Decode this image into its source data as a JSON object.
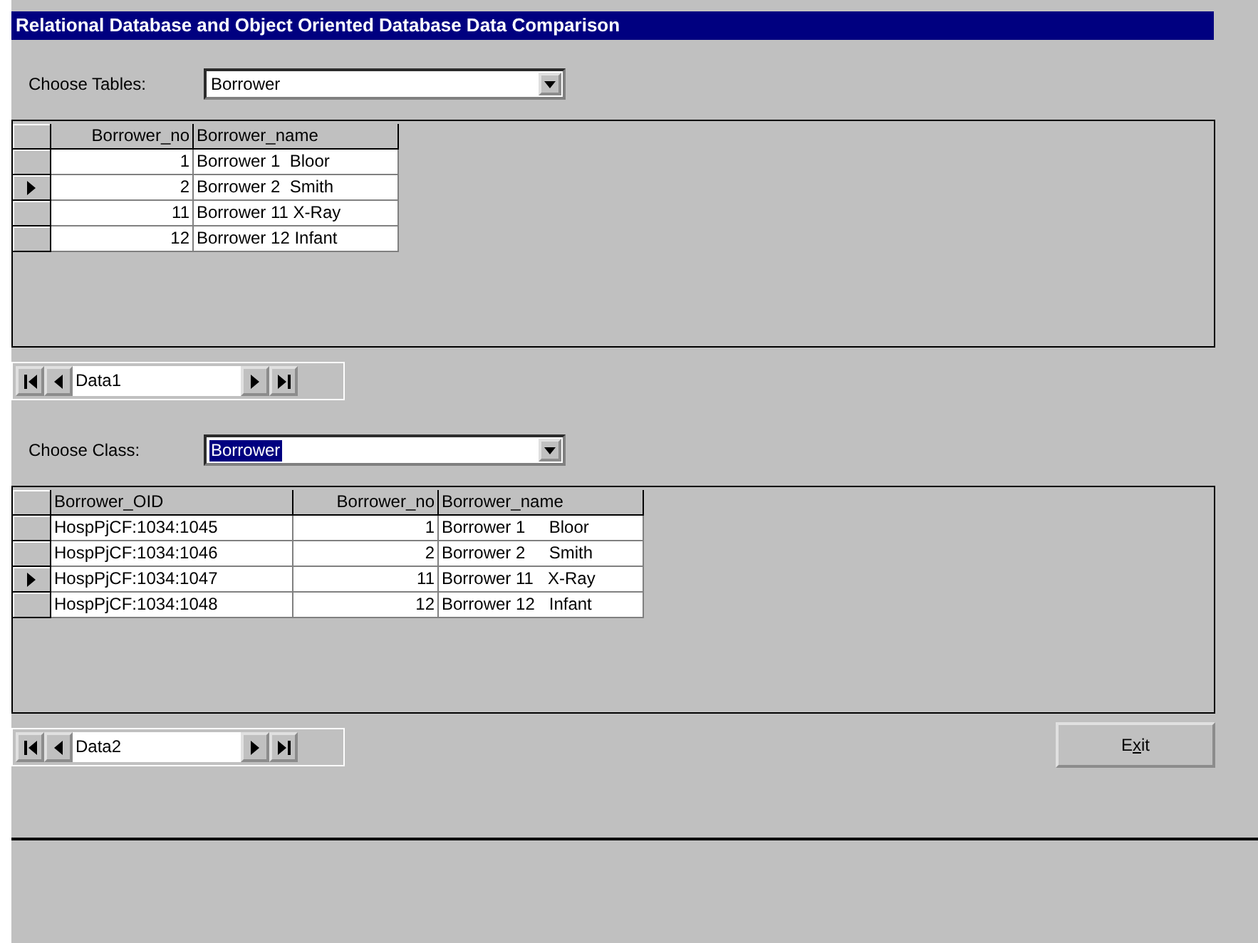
{
  "window": {
    "title": "Relational Database and Object Oriented Database Data Comparison"
  },
  "tables_chooser": {
    "label": "Choose Tables:",
    "value": "Borrower",
    "text_selected": false
  },
  "tables_grid": {
    "columns": [
      {
        "label": "Borrower_no"
      },
      {
        "label": "Borrower_name"
      }
    ],
    "rows": [
      {
        "selected": false,
        "cells": [
          "1",
          "Borrower 1  Bloor"
        ]
      },
      {
        "selected": true,
        "cells": [
          "2",
          "Borrower 2  Smith"
        ]
      },
      {
        "selected": false,
        "cells": [
          "11",
          "Borrower 11 X-Ray"
        ]
      },
      {
        "selected": false,
        "cells": [
          "12",
          "Borrower 12 Infant"
        ]
      }
    ]
  },
  "data_control_1": {
    "caption": "Data1"
  },
  "class_chooser": {
    "label": "Choose Class:",
    "value": "Borrower",
    "text_selected": true
  },
  "class_grid": {
    "columns": [
      {
        "label": "Borrower_OID"
      },
      {
        "label": "Borrower_no"
      },
      {
        "label": "Borrower_name"
      }
    ],
    "rows": [
      {
        "selected": false,
        "cells": [
          "HospPjCF:1034:1045",
          "1",
          "Borrower 1     Bloor"
        ]
      },
      {
        "selected": false,
        "cells": [
          "HospPjCF:1034:1046",
          "2",
          "Borrower 2     Smith"
        ]
      },
      {
        "selected": true,
        "cells": [
          "HospPjCF:1034:1047",
          "11",
          "Borrower 11   X-Ray"
        ]
      },
      {
        "selected": false,
        "cells": [
          "HospPjCF:1034:1048",
          "12",
          "Borrower 12   Infant"
        ]
      }
    ]
  },
  "data_control_2": {
    "caption": "Data2"
  },
  "exit_button": {
    "label": "Exit"
  }
}
